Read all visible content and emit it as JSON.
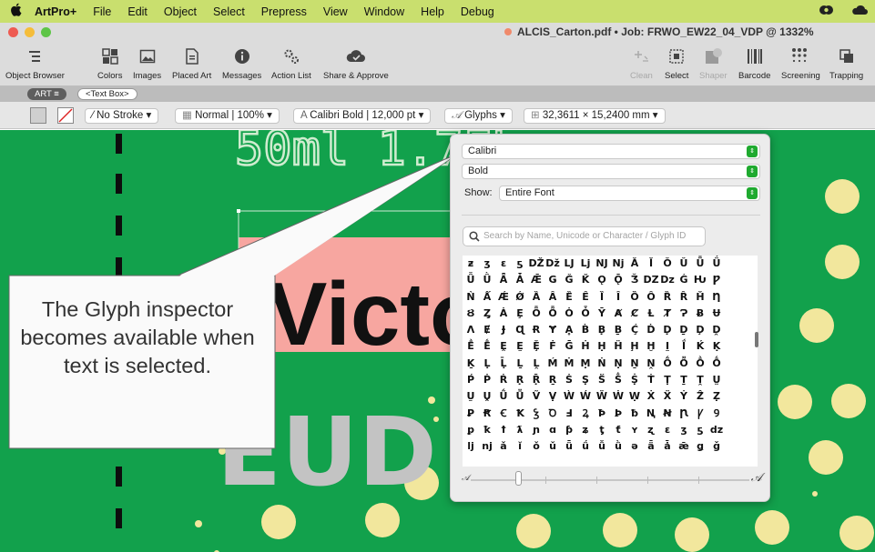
{
  "menubar": {
    "apple_icon": "apple-icon",
    "app_name": "ArtPro+",
    "items": [
      "File",
      "Edit",
      "Object",
      "Select",
      "Prepress",
      "View",
      "Window",
      "Help",
      "Debug"
    ]
  },
  "window": {
    "title": "ALCIS_Carton.pdf • Job: FRWO_EW22_04_VDP @ 1332%"
  },
  "toolbar": {
    "left": [
      {
        "label": "Object Browser",
        "icon": "object-browser-icon"
      },
      {
        "label": "Colors",
        "icon": "colors-icon"
      },
      {
        "label": "Images",
        "icon": "images-icon"
      },
      {
        "label": "Placed Art",
        "icon": "placed-art-icon"
      },
      {
        "label": "Messages",
        "icon": "info-icon"
      },
      {
        "label": "Action List",
        "icon": "gears-icon"
      },
      {
        "label": "Share & Approve",
        "icon": "cloud-icon"
      }
    ],
    "right": [
      {
        "label": "Clean",
        "icon": "clean-icon",
        "enabled": false
      },
      {
        "label": "Select",
        "icon": "select-icon",
        "enabled": true
      },
      {
        "label": "Shaper",
        "icon": "shaper-icon",
        "enabled": false
      },
      {
        "label": "Barcode",
        "icon": "barcode-icon",
        "enabled": true
      },
      {
        "label": "Screening",
        "icon": "screening-icon",
        "enabled": true
      },
      {
        "label": "Trapping",
        "icon": "trapping-icon",
        "enabled": true
      }
    ]
  },
  "breadcrumb": {
    "art": "ART ≡",
    "text_box": "<Text Box>"
  },
  "propbar": {
    "stroke": "No Stroke",
    "blend": "Normal | 100%",
    "font": "Calibri Bold | 12,000 pt",
    "glyphs": "Glyphs",
    "size": "32,3611 × 15,2400 mm"
  },
  "canvas": {
    "top_text": "50ml 1.7FL",
    "pink_text": "Victo",
    "gray_text": "EUD"
  },
  "callout": {
    "text": "The Glyph inspector becomes available when text is selected."
  },
  "glyph_panel": {
    "font_family": "Calibri",
    "font_style": "Bold",
    "show_label": "Show:",
    "show_value": "Entire Font",
    "search_placeholder": "Search by Name, Unicode or Character / Glyph ID",
    "rows": [
      [
        "ƶ",
        "ʒ",
        "ɛ",
        "ƽ",
        "Ǆ",
        "ǅ",
        "Ǉ",
        "ǈ",
        "Ǌ",
        "ǋ",
        "Ǎ",
        "Ǐ",
        "Ǒ",
        "Ǔ",
        "Ǖ",
        "Ǘ"
      ],
      [
        "Ǚ",
        "Ǜ",
        "Ǟ",
        "Ǡ",
        "Ǣ",
        "Ǥ",
        "Ǧ",
        "Ǩ",
        "Ǫ",
        "Ǭ",
        "Ǯ",
        "Ǳ",
        "ǲ",
        "Ǵ",
        "Ƕ",
        "Ƿ"
      ],
      [
        "Ǹ",
        "Ǻ",
        "Ǽ",
        "Ǿ",
        "Ȁ",
        "Ȃ",
        "Ȅ",
        "Ȇ",
        "Ȉ",
        "Ȋ",
        "Ȍ",
        "Ȏ",
        "Ȑ",
        "Ȓ",
        "Ȟ",
        "Ƞ"
      ],
      [
        "Ȣ",
        "Ȥ",
        "Ȧ",
        "Ȩ",
        "Ȫ",
        "Ȭ",
        "Ȯ",
        "Ȱ",
        "Ȳ",
        "Ⱥ",
        "Ȼ",
        "Ƚ",
        "Ⱦ",
        "Ɂ",
        "Ƀ",
        "Ʉ"
      ],
      [
        "Ʌ",
        "Ɇ",
        "Ɉ",
        "Ɋ",
        "Ɍ",
        "Ɏ",
        "Ḁ",
        "Ḃ",
        "Ḅ",
        "Ḇ",
        "Ḉ",
        "Ḋ",
        "Ḍ",
        "Ḏ",
        "Ḑ",
        "Ḓ"
      ],
      [
        "Ḕ",
        "Ḗ",
        "Ḙ",
        "Ḛ",
        "Ḝ",
        "Ḟ",
        "Ḡ",
        "Ḣ",
        "Ḥ",
        "Ḧ",
        "Ḩ",
        "Ḫ",
        "Ḭ",
        "Ḯ",
        "Ḱ",
        "Ḳ"
      ],
      [
        "Ḵ",
        "Ḷ",
        "Ḹ",
        "Ḻ",
        "Ḽ",
        "Ḿ",
        "Ṁ",
        "Ṃ",
        "Ṅ",
        "Ṇ",
        "Ṉ",
        "Ṋ",
        "Ṍ",
        "Ṏ",
        "Ṑ",
        "Ṓ"
      ],
      [
        "Ṕ",
        "Ṗ",
        "Ṙ",
        "Ṛ",
        "Ṝ",
        "Ṟ",
        "Ṡ",
        "Ṣ",
        "Ṥ",
        "Ṧ",
        "Ṩ",
        "Ṫ",
        "Ṭ",
        "Ṯ",
        "Ṱ",
        "Ṳ"
      ],
      [
        "Ṵ",
        "Ṷ",
        "Ṹ",
        "Ṻ",
        "Ṽ",
        "Ṿ",
        "Ẁ",
        "Ẃ",
        "Ẅ",
        "Ẇ",
        "Ẉ",
        "Ẋ",
        "Ẍ",
        "Ẏ",
        "Ẑ",
        "Ẓ"
      ],
      [
        "Ꝑ",
        "Ꞧ",
        "Ꞓ",
        "Ꝁ",
        "Ꝣ",
        "Ꝺ",
        "Ⅎ",
        "Ꝝ",
        "Ꝥ",
        "Ꝧ",
        "ƀ",
        "Ꞑ",
        "Ꞥ",
        "Ꞃ",
        "Ꝩ",
        "Ꝯ"
      ],
      [
        "ꝑ",
        "ꝁ",
        "ꝉ",
        "ƛ",
        "ɲ",
        "ɑ",
        "ƥ",
        "ʑ",
        "ƫ",
        "ƭ",
        "ʏ",
        "ʐ",
        "ɛ",
        "ʒ",
        "ƽ",
        "ǳ"
      ],
      [
        "ǉ",
        "ǌ",
        "ǎ",
        "ǐ",
        "ǒ",
        "ǔ",
        "ǖ",
        "ǘ",
        "ǚ",
        "ǜ",
        "ǝ",
        "ǟ",
        "ǡ",
        "ǣ",
        "ǥ",
        "ǧ"
      ]
    ]
  }
}
